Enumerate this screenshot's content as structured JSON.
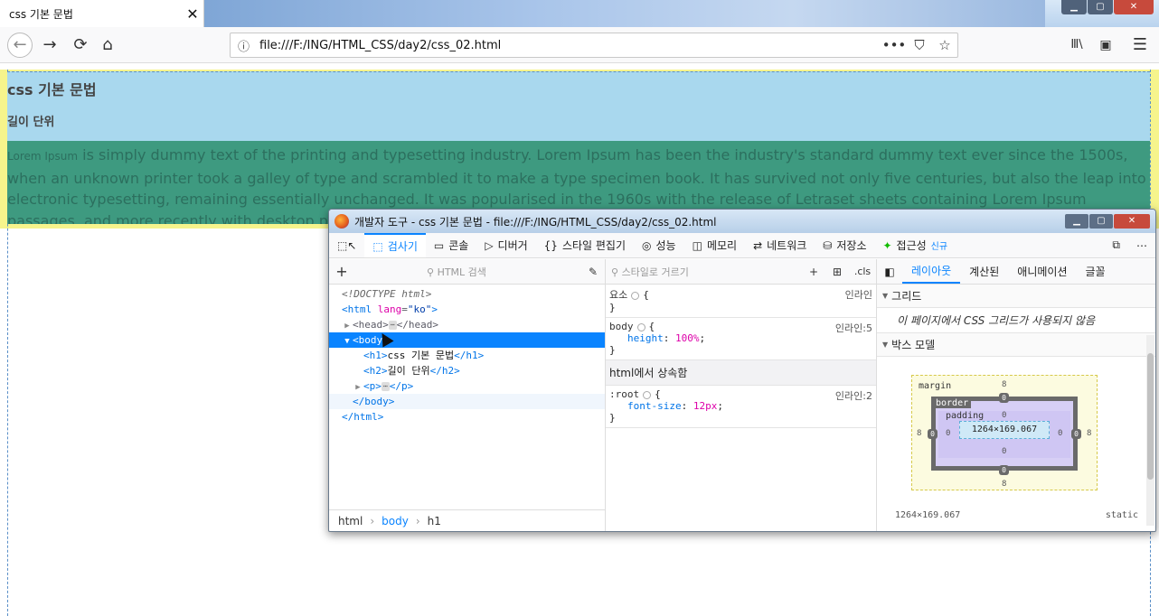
{
  "browser": {
    "tab_title": "css 기본 문법",
    "tab_close": "✕",
    "url": "file:///F:/ING/HTML_CSS/day2/css_02.html",
    "url_actions": [
      "•••",
      "⛉",
      "☆"
    ],
    "toolbar_right": [
      "Ⅲ\\",
      "▣",
      "☰"
    ],
    "window_buttons": [
      "▁",
      "▢",
      "✕"
    ]
  },
  "page": {
    "h1": "css 기본 문법",
    "h2": "길이 단위",
    "paragraph_lead": "Lorem Ipsum",
    "paragraph_rest": " is simply dummy text of the printing and typesetting industry. Lorem Ipsum has been the industry's standard dummy text ever since the 1500s, when an unknown printer took a galley of type and scrambled it to make a type specimen book. It has survived not only five centuries, but also the leap into electronic typesetting, remaining essentially unchanged. It was popularised in the 1960s with the release of Letraset sheets containing Lorem Ipsum passages, and more recently with desktop publishing software like Aldus PageMaker including versions of Lorem Ipsum."
  },
  "devtools": {
    "window_title": "개발자 도구 - css 기본 문법 - file:///F:/ING/HTML_CSS/day2/css_02.html",
    "tools": [
      {
        "icon": "⬚",
        "label": "검사기"
      },
      {
        "icon": "▭",
        "label": "콘솔"
      },
      {
        "icon": "▷",
        "label": "디버거"
      },
      {
        "icon": "{}",
        "label": "스타일 편집기"
      },
      {
        "icon": "◎",
        "label": "성능"
      },
      {
        "icon": "◫",
        "label": "메모리"
      },
      {
        "icon": "⇄",
        "label": "네트워크"
      },
      {
        "icon": "⛁",
        "label": "저장소"
      },
      {
        "icon": "✦",
        "label": "접근성",
        "badge": "신규"
      }
    ],
    "inspector": {
      "search_placeholder": "HTML 검색",
      "markup": {
        "doctype": "<!DOCTYPE html>",
        "html_open_tag": "<html",
        "html_attr": "lang",
        "html_attr_val": "\"ko\"",
        "html_close_bracket": ">",
        "head": "<head>",
        "head_close": "</head>",
        "ellipsis": "⋯",
        "body": "<body>",
        "h1_open": "<h1>",
        "h1_text": "css 기본 문법",
        "h1_close": "</h1>",
        "h2_open": "<h2>",
        "h2_text": "길이 단위",
        "h2_close": "</h2>",
        "p_open": "<p>",
        "p_close": "</p>",
        "body_close": "</body>",
        "html_close": "</html>"
      },
      "breadcrumbs": [
        "html",
        "body",
        "h1"
      ]
    },
    "rules": {
      "filter_placeholder": "스타일로 거르기",
      "cls": ".cls",
      "element_selector": "요소",
      "element_src": "인라인",
      "body_selector": "body",
      "body_src": "인라인:5",
      "body_prop": "height",
      "body_val": "100%",
      "inherit_head": "html에서 상속함",
      "root_selector": ":root",
      "root_src": "인라인:2",
      "root_prop": "font-size",
      "root_val": "12px"
    },
    "sidebar": {
      "tabs": [
        "레이아웃",
        "계산된",
        "애니메이션",
        "글꼴"
      ],
      "grid_head": "그리드",
      "grid_msg": "이 페이지에서 CSS 그리드가 사용되지 않음",
      "box_head": "박스 모델",
      "box": {
        "margin_label": "margin",
        "border_label": "border",
        "padding_label": "padding",
        "content_size": "1264×169.067",
        "margin": "8",
        "border": "0",
        "padding": "0",
        "footer_size": "1264×169.067",
        "footer_pos": "static"
      }
    }
  }
}
